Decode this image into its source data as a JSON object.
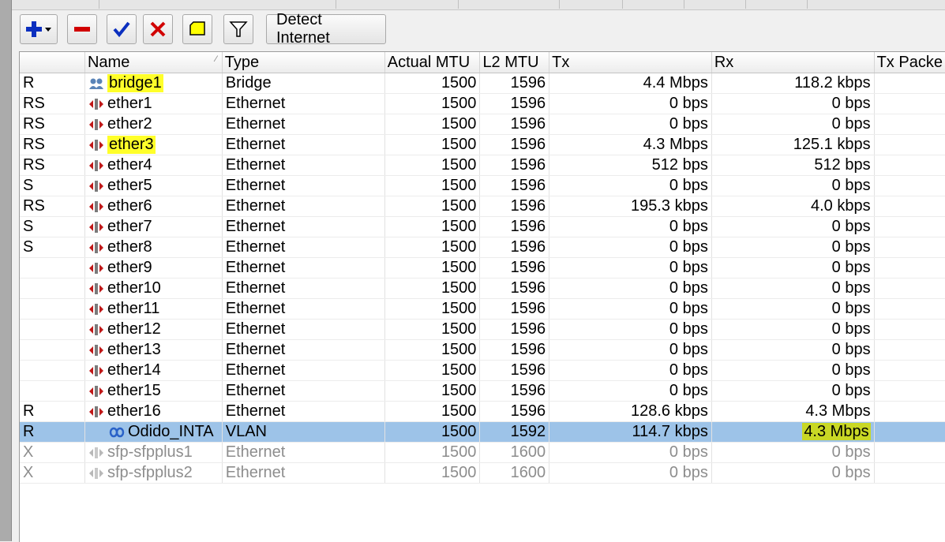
{
  "toolbar": {
    "detect_internet_label": "Detect Internet",
    "icons": [
      "add-dropdown-icon",
      "remove-icon",
      "enable-check-icon",
      "disable-x-icon",
      "comment-icon",
      "filter-icon"
    ],
    "colors": {
      "add": "#0b2fbf",
      "remove": "#d10000",
      "check": "#0b2fbf",
      "x": "#d10000",
      "comment": "#ffff00",
      "filter": "#ffffff"
    }
  },
  "columns": {
    "flags": "",
    "name": "Name",
    "type": "Type",
    "actual_mtu": "Actual MTU",
    "l2_mtu": "L2 MTU",
    "tx": "Tx",
    "rx": "Rx",
    "tx_packets": "Tx Packe"
  },
  "rows": [
    {
      "flags": "R",
      "name": "bridge1",
      "type": "Bridge",
      "mtu": "1500",
      "l2mtu": "1596",
      "tx": "4.4 Mbps",
      "rx": "118.2 kbps",
      "icon": "bridge-icon"
    },
    {
      "flags": "RS",
      "name": "ether1",
      "type": "Ethernet",
      "mtu": "1500",
      "l2mtu": "1596",
      "tx": "0 bps",
      "rx": "0 bps",
      "icon": "ethernet-icon"
    },
    {
      "flags": "RS",
      "name": "ether2",
      "type": "Ethernet",
      "mtu": "1500",
      "l2mtu": "1596",
      "tx": "0 bps",
      "rx": "0 bps",
      "icon": "ethernet-icon"
    },
    {
      "flags": "RS",
      "name": "ether3",
      "type": "Ethernet",
      "mtu": "1500",
      "l2mtu": "1596",
      "tx": "4.3 Mbps",
      "rx": "125.1 kbps",
      "icon": "ethernet-icon"
    },
    {
      "flags": "RS",
      "name": "ether4",
      "type": "Ethernet",
      "mtu": "1500",
      "l2mtu": "1596",
      "tx": "512 bps",
      "rx": "512 bps",
      "icon": "ethernet-icon"
    },
    {
      "flags": "S",
      "name": "ether5",
      "type": "Ethernet",
      "mtu": "1500",
      "l2mtu": "1596",
      "tx": "0 bps",
      "rx": "0 bps",
      "icon": "ethernet-icon"
    },
    {
      "flags": "RS",
      "name": "ether6",
      "type": "Ethernet",
      "mtu": "1500",
      "l2mtu": "1596",
      "tx": "195.3 kbps",
      "rx": "4.0 kbps",
      "icon": "ethernet-icon"
    },
    {
      "flags": "S",
      "name": "ether7",
      "type": "Ethernet",
      "mtu": "1500",
      "l2mtu": "1596",
      "tx": "0 bps",
      "rx": "0 bps",
      "icon": "ethernet-icon"
    },
    {
      "flags": "S",
      "name": "ether8",
      "type": "Ethernet",
      "mtu": "1500",
      "l2mtu": "1596",
      "tx": "0 bps",
      "rx": "0 bps",
      "icon": "ethernet-icon"
    },
    {
      "flags": "",
      "name": "ether9",
      "type": "Ethernet",
      "mtu": "1500",
      "l2mtu": "1596",
      "tx": "0 bps",
      "rx": "0 bps",
      "icon": "ethernet-icon"
    },
    {
      "flags": "",
      "name": "ether10",
      "type": "Ethernet",
      "mtu": "1500",
      "l2mtu": "1596",
      "tx": "0 bps",
      "rx": "0 bps",
      "icon": "ethernet-icon"
    },
    {
      "flags": "",
      "name": "ether11",
      "type": "Ethernet",
      "mtu": "1500",
      "l2mtu": "1596",
      "tx": "0 bps",
      "rx": "0 bps",
      "icon": "ethernet-icon"
    },
    {
      "flags": "",
      "name": "ether12",
      "type": "Ethernet",
      "mtu": "1500",
      "l2mtu": "1596",
      "tx": "0 bps",
      "rx": "0 bps",
      "icon": "ethernet-icon"
    },
    {
      "flags": "",
      "name": "ether13",
      "type": "Ethernet",
      "mtu": "1500",
      "l2mtu": "1596",
      "tx": "0 bps",
      "rx": "0 bps",
      "icon": "ethernet-icon"
    },
    {
      "flags": "",
      "name": "ether14",
      "type": "Ethernet",
      "mtu": "1500",
      "l2mtu": "1596",
      "tx": "0 bps",
      "rx": "0 bps",
      "icon": "ethernet-icon"
    },
    {
      "flags": "",
      "name": "ether15",
      "type": "Ethernet",
      "mtu": "1500",
      "l2mtu": "1596",
      "tx": "0 bps",
      "rx": "0 bps",
      "icon": "ethernet-icon"
    },
    {
      "flags": "R",
      "name": "ether16",
      "type": "Ethernet",
      "mtu": "1500",
      "l2mtu": "1596",
      "tx": "128.6 kbps",
      "rx": "4.3 Mbps",
      "icon": "ethernet-icon"
    },
    {
      "flags": "R",
      "name": "Odido_INTA",
      "type": "VLAN",
      "mtu": "1500",
      "l2mtu": "1592",
      "tx": "114.7 kbps",
      "rx": "4.3 Mbps",
      "icon": "vlan-icon"
    },
    {
      "flags": "X",
      "name": "sfp-sfpplus1",
      "type": "Ethernet",
      "mtu": "1500",
      "l2mtu": "1600",
      "tx": "0 bps",
      "rx": "0 bps",
      "icon": "ethernet-icon"
    },
    {
      "flags": "X",
      "name": "sfp-sfpplus2",
      "type": "Ethernet",
      "mtu": "1500",
      "l2mtu": "1600",
      "tx": "0 bps",
      "rx": "0 bps",
      "icon": "ethernet-icon"
    }
  ],
  "highlight_colors": {
    "yellow": "#ffff2a",
    "olive": "#c9d825",
    "selected_row": "#9dc3e8"
  }
}
